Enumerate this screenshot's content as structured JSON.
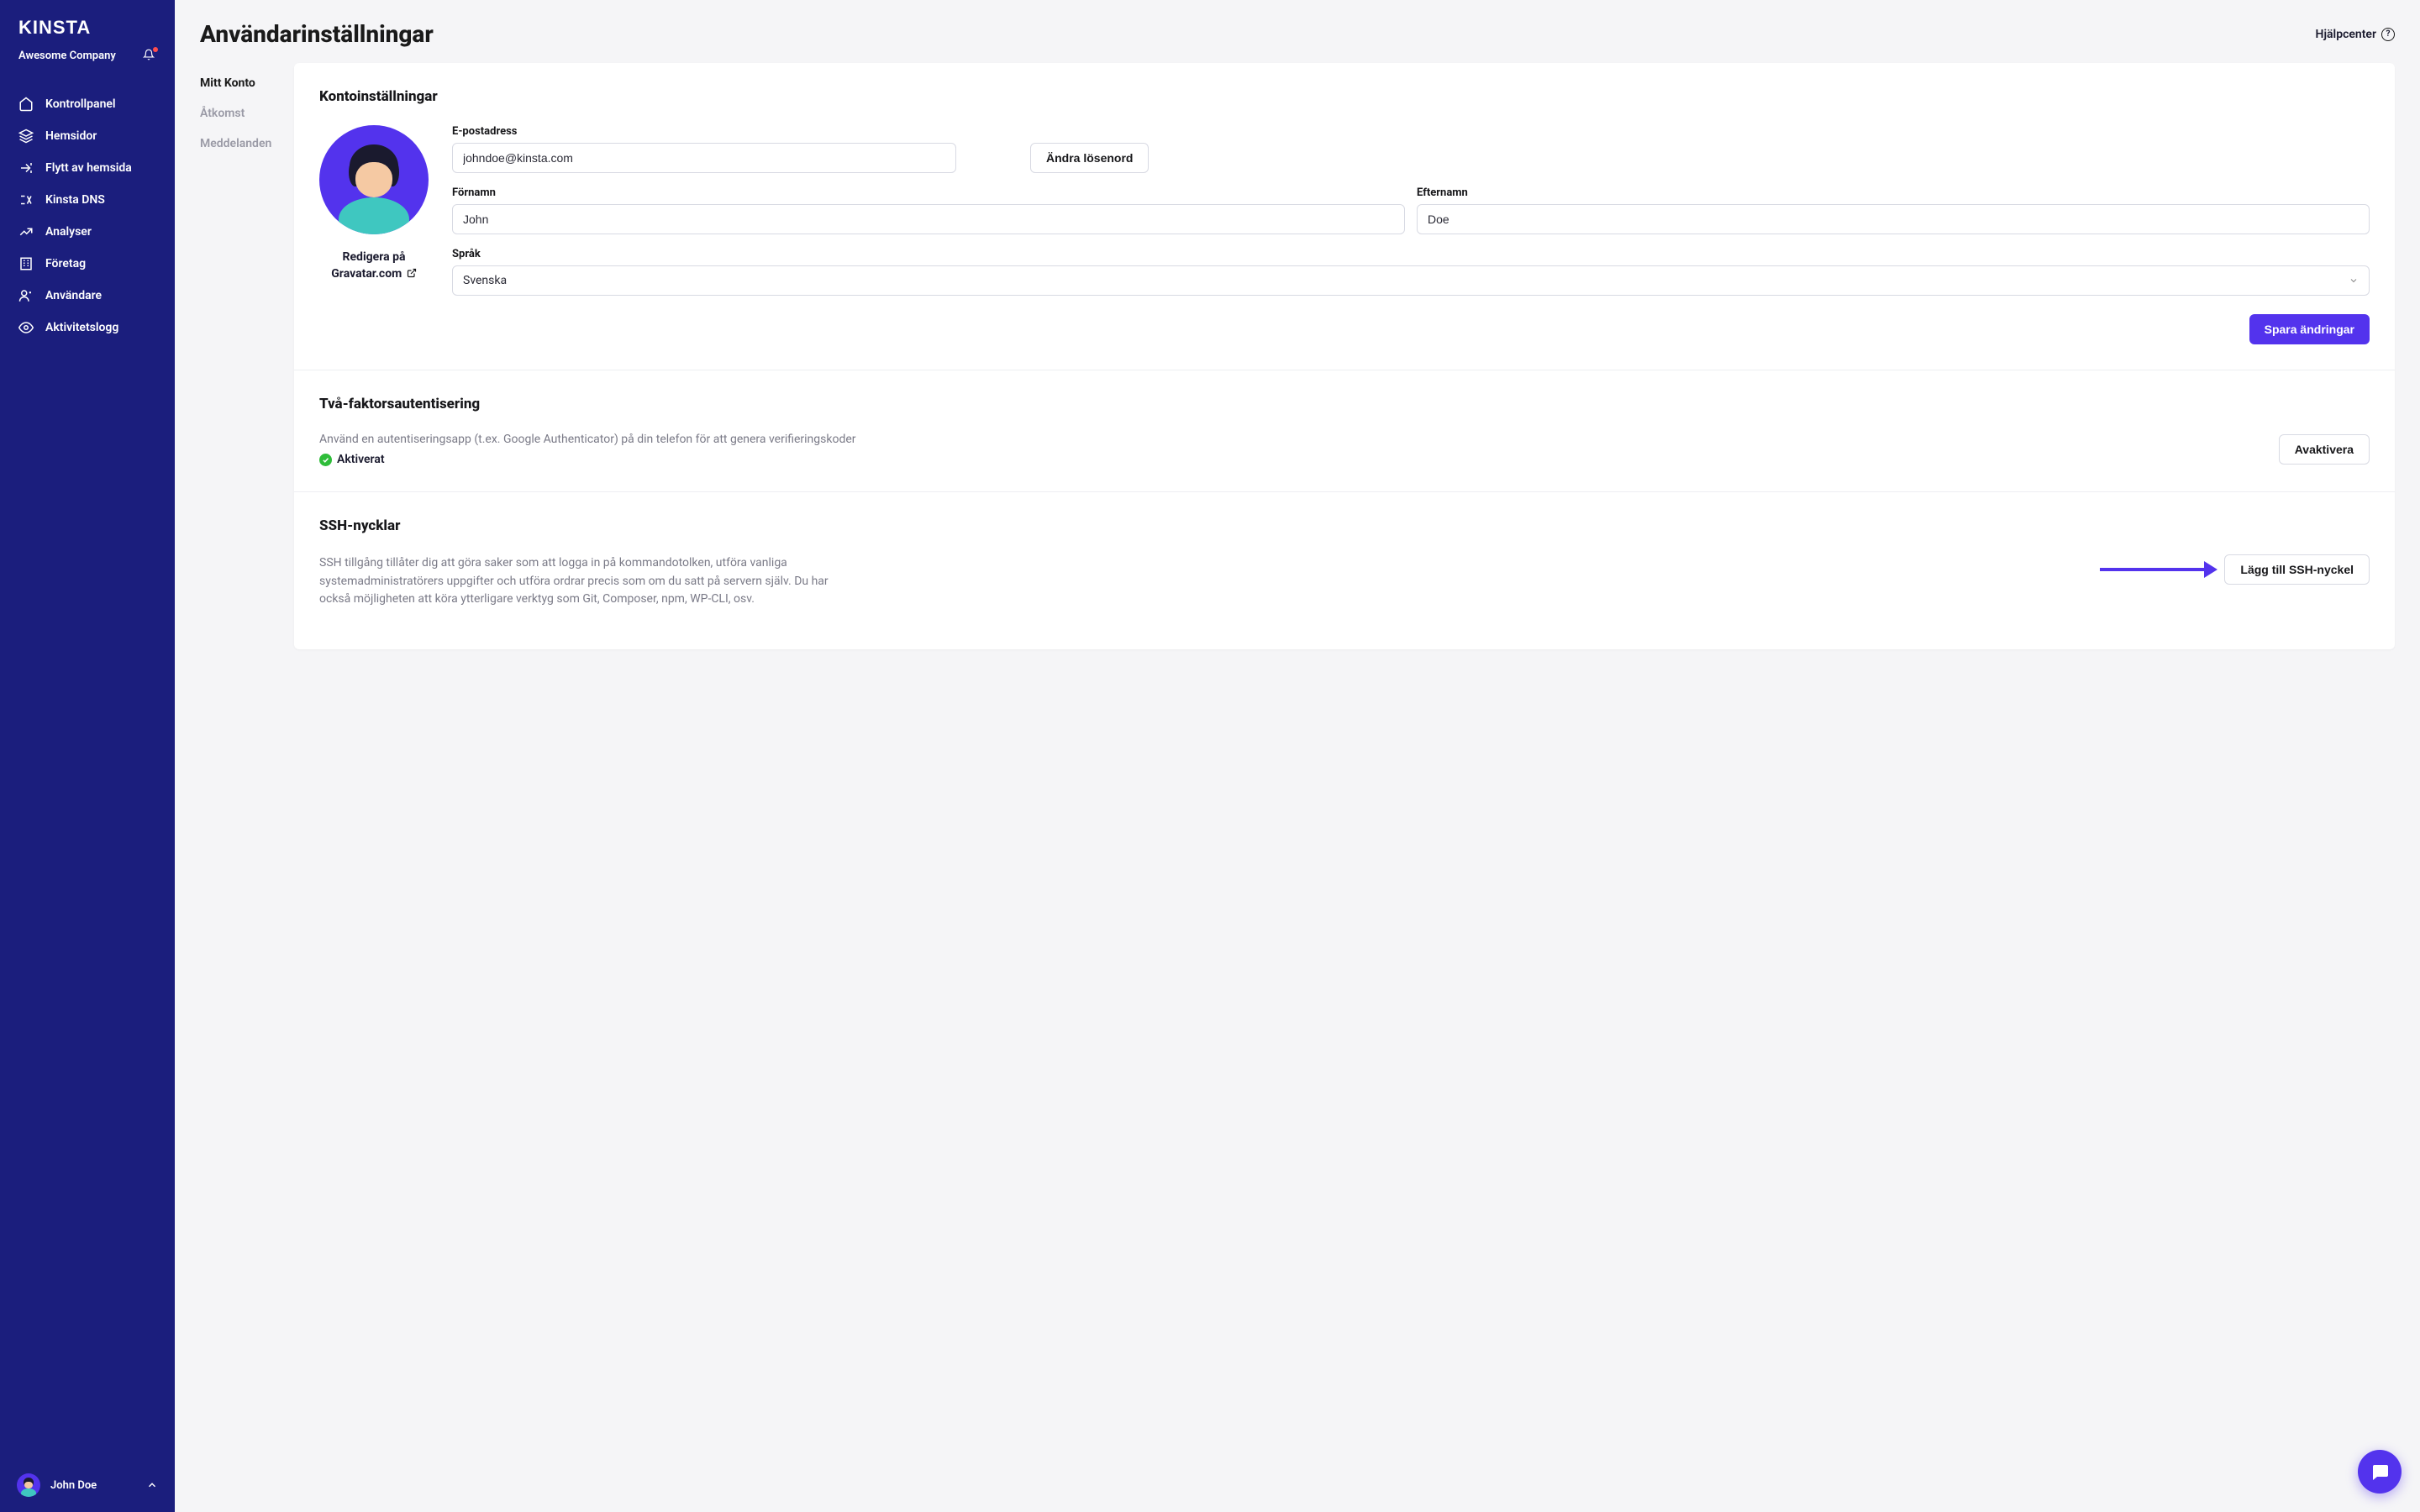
{
  "brand": "KINSTA",
  "company": "Awesome Company",
  "sidebar": {
    "items": [
      {
        "label": "Kontrollpanel"
      },
      {
        "label": "Hemsidor"
      },
      {
        "label": "Flytt av hemsida"
      },
      {
        "label": "Kinsta DNS"
      },
      {
        "label": "Analyser"
      },
      {
        "label": "Företag"
      },
      {
        "label": "Användare"
      },
      {
        "label": "Aktivitetslogg"
      }
    ]
  },
  "user": {
    "name": "John Doe"
  },
  "header": {
    "title": "Användarinställningar",
    "helpcenter": "Hjälpcenter"
  },
  "subnav": {
    "items": [
      {
        "label": "Mitt Konto",
        "active": true
      },
      {
        "label": "Åtkomst",
        "active": false
      },
      {
        "label": "Meddelanden",
        "active": false
      }
    ]
  },
  "account": {
    "section_title": "Kontoinställningar",
    "gravatar_line1": "Redigera på",
    "gravatar_line2": "Gravatar.com",
    "email_label": "E-postadress",
    "email_value": "johndoe@kinsta.com",
    "change_password": "Ändra lösenord",
    "firstname_label": "Förnamn",
    "firstname_value": "John",
    "lastname_label": "Efternamn",
    "lastname_value": "Doe",
    "language_label": "Språk",
    "language_value": "Svenska",
    "save_button": "Spara ändringar"
  },
  "twofa": {
    "section_title": "Två-faktorsautentisering",
    "description": "Använd en autentiseringsapp (t.ex. Google Authenticator) på din telefon för att genera verifieringskoder",
    "status": "Aktiverat",
    "deactivate": "Avaktivera"
  },
  "ssh": {
    "section_title": "SSH-nycklar",
    "description": "SSH tillgång tillåter dig att göra saker som att logga in på kommandotolken, utföra vanliga systemadministratörers uppgifter och utföra ordrar precis som om du satt på servern själv. Du har också möjligheten att köra ytterligare verktyg som Git, Composer, npm, WP-CLI, osv.",
    "add_button": "Lägg till SSH-nyckel"
  },
  "colors": {
    "primary": "#5333ed",
    "sidebar": "#1b1e7d"
  }
}
